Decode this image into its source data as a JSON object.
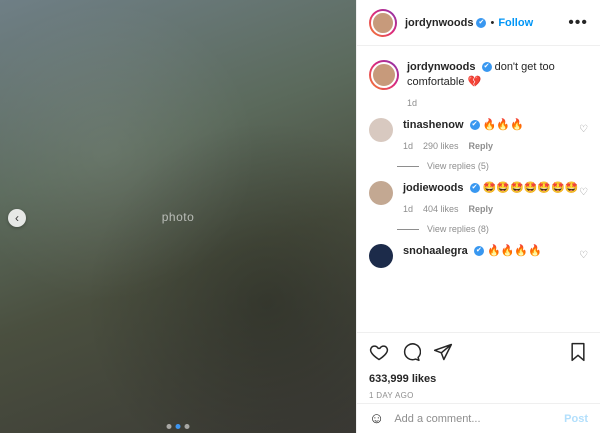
{
  "media": {
    "placeholder": "photo"
  },
  "post": {
    "username": "jordynwoods",
    "follow_label": "Follow",
    "separator": "•",
    "caption": "don't get too comfortable",
    "caption_emoji": "💔",
    "caption_age": "1d"
  },
  "comments": [
    {
      "username": "tinashenow",
      "text": "🔥🔥🔥",
      "age": "1d",
      "likes": "290 likes",
      "reply_label": "Reply",
      "view_replies": "View replies (5)"
    },
    {
      "username": "jodiewoods",
      "text": "🤩🤩🤩🤩🤩🤩🤩",
      "age": "1d",
      "likes": "404 likes",
      "reply_label": "Reply",
      "view_replies": "View replies (8)"
    },
    {
      "username": "snohaalegra",
      "text": "🔥🔥🔥🔥"
    }
  ],
  "footer": {
    "likes_count": "633,999 likes",
    "time_ago": "1 DAY AGO",
    "comment_placeholder": "Add a comment...",
    "post_label": "Post"
  },
  "icons": {
    "verified": "✔",
    "more": "•••",
    "heart_small": "♡",
    "carousel_prev": "‹",
    "emoji": "☺"
  }
}
